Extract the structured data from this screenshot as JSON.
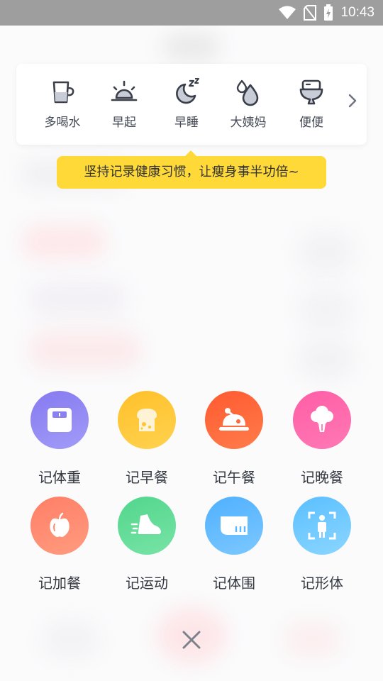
{
  "status_bar": {
    "time": "10:43"
  },
  "quick_records": {
    "items": [
      {
        "label": "多喝水",
        "icon": "cup-icon"
      },
      {
        "label": "早起",
        "icon": "sunrise-icon"
      },
      {
        "label": "早睡",
        "icon": "moon-sleep-icon"
      },
      {
        "label": "大姨妈",
        "icon": "drops-icon"
      },
      {
        "label": "便便",
        "icon": "toilet-icon"
      }
    ],
    "more_icon": "chevron-right-icon"
  },
  "tooltip": {
    "text": "坚持记录健康习惯，让瘦身事半功倍~"
  },
  "actions": [
    {
      "label": "记体重",
      "icon": "scale-icon",
      "color": "#8e82f2"
    },
    {
      "label": "记早餐",
      "icon": "toast-icon",
      "color": "#ffc533"
    },
    {
      "label": "记午餐",
      "icon": "roast-chicken-icon",
      "color": "#ff6336"
    },
    {
      "label": "记晚餐",
      "icon": "broccoli-icon",
      "color": "#ff66a8"
    },
    {
      "label": "记加餐",
      "icon": "apple-icon",
      "color": "#ff8a72"
    },
    {
      "label": "记运动",
      "icon": "running-shoe-icon",
      "color": "#5fdb96"
    },
    {
      "label": "记体围",
      "icon": "measuring-tape-icon",
      "color": "#5bb8ff"
    },
    {
      "label": "记形体",
      "icon": "body-shape-icon",
      "color": "#6bc8ff"
    }
  ],
  "close_icon": "close-icon"
}
